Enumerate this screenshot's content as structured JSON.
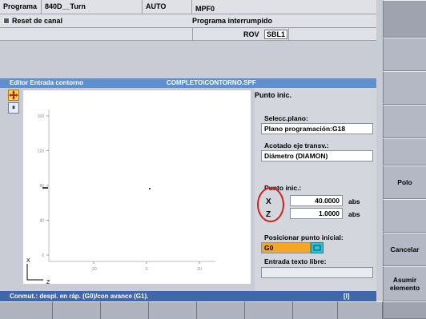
{
  "header": {
    "programa_label": "Programa",
    "program_name": "840D__Turn",
    "mode": "AUTO",
    "file": "MPF0",
    "channel_reset": "Reset de canal",
    "program_status": "Programa interrumpido",
    "rov": "ROV",
    "sbl": "SBL1"
  },
  "editor": {
    "title_left": "Editor  Entrada contorno",
    "title_path": "COMPLETO\\CONTORNO.SPF",
    "panel_title": "Punto inic."
  },
  "graphic": {
    "y_ticks": [
      "160",
      "120",
      "80",
      "40",
      "0"
    ],
    "x_ticks": [
      "-20",
      "0",
      "20"
    ],
    "axis_x_label": "Z",
    "axis_y_label": "X"
  },
  "form": {
    "plane_label": "Selecc.plano:",
    "plane_value": "Plano programación:G18",
    "dim_label": "Acotado eje transv.:",
    "dim_value": "Diámetro (DIAMON)",
    "start_label": "Punto inic.:",
    "x_name": "X",
    "x_value": "40.0000",
    "x_unit": "abs",
    "z_name": "Z",
    "z_value": "1.0000",
    "z_unit": "abs",
    "position_label": "Posicionar punto inicial:",
    "position_value": "G0",
    "freetext_label": "Entrada texto libre:",
    "freetext_value": ""
  },
  "status_bar": {
    "message": "Conmut.: despl. en ráp. (G0)/con avance (G1).",
    "indicator": "[I]"
  },
  "softkeys": {
    "polo": "Polo",
    "cancelar": "Cancelar",
    "asumir": "Asumir elemento"
  },
  "colors": {
    "title_bar": "#5e8fcf",
    "status_bar": "#3f67a9",
    "highlight_field": "#f5a623",
    "toggle_button": "#2fc3d4",
    "annotation_circle": "#d0201a"
  }
}
